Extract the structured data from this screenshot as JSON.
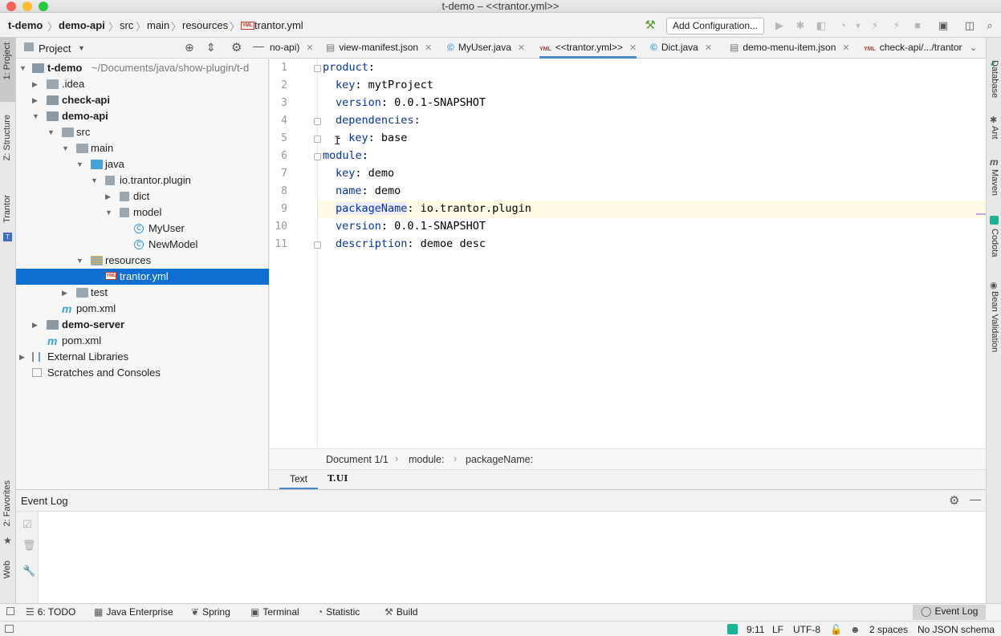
{
  "window": {
    "title": "t-demo – <<trantor.yml>>"
  },
  "nav": {
    "crumbs": [
      "t-demo",
      "demo-api",
      "src",
      "main",
      "resources",
      "trantor.yml"
    ],
    "add_config": "Add Configuration..."
  },
  "left_strip": {
    "project": "1: Project",
    "structure": "Z: Structure",
    "trantor": "Trantor",
    "favorites": "2: Favorites",
    "web": "Web"
  },
  "right_strip": {
    "database": "Database",
    "ant": "Ant",
    "maven": "Maven",
    "codota": "Codota",
    "bean": "Bean Validation"
  },
  "project": {
    "header": "Project",
    "tree": [
      {
        "label": "t-demo",
        "extra": "~/Documents/java/show-plugin/t-d",
        "bold": true
      },
      {
        "label": ".idea"
      },
      {
        "label": "check-api",
        "bold": true
      },
      {
        "label": "demo-api",
        "bold": true
      },
      {
        "label": "src"
      },
      {
        "label": "main"
      },
      {
        "label": "java"
      },
      {
        "label": "io.trantor.plugin"
      },
      {
        "label": "dict"
      },
      {
        "label": "model"
      },
      {
        "label": "MyUser"
      },
      {
        "label": "NewModel"
      },
      {
        "label": "resources"
      },
      {
        "label": "trantor.yml"
      },
      {
        "label": "test"
      },
      {
        "label": "pom.xml"
      },
      {
        "label": "demo-server",
        "bold": true
      },
      {
        "label": "pom.xml"
      },
      {
        "label": "External Libraries"
      },
      {
        "label": "Scratches and Consoles"
      }
    ]
  },
  "tabs": [
    "no-api)",
    "view-manifest.json",
    "MyUser.java",
    "<<trantor.yml>>",
    "Dict.java",
    "demo-menu-item.json",
    "check-api/.../trantor"
  ],
  "editor": {
    "lines": [
      {
        "n": "1",
        "k": "product",
        "v": ""
      },
      {
        "n": "2",
        "k": "key",
        "v": " mytProject"
      },
      {
        "n": "3",
        "k": "version",
        "v": " 0.0.1-SNAPSHOT"
      },
      {
        "n": "4",
        "k": "dependencies",
        "v": ""
      },
      {
        "n": "5",
        "k": "key",
        "v": " base"
      },
      {
        "n": "6",
        "k": "module",
        "v": ""
      },
      {
        "n": "7",
        "k": "key",
        "v": " demo"
      },
      {
        "n": "8",
        "k": "name",
        "v": " demo"
      },
      {
        "n": "9",
        "k": "packageName",
        "v": " io.trantor.plugin"
      },
      {
        "n": "10",
        "k": "version",
        "v": " 0.0.1-SNAPSHOT"
      },
      {
        "n": "11",
        "k": "description",
        "v": " demoe desc"
      }
    ],
    "dash": "- ",
    "breadcrumb": [
      "Document 1/1",
      "module:",
      "packageName:"
    ],
    "modes": [
      "Text",
      "T.UI"
    ]
  },
  "event_log": {
    "title": "Event Log"
  },
  "toolwindows": {
    "todo": "6: TODO",
    "java_ent": "Java Enterprise",
    "spring": "Spring",
    "terminal": "Terminal",
    "statistic": "Statistic",
    "build": "Build",
    "event_log": "Event Log"
  },
  "status": {
    "pos": "9:11",
    "lf": "LF",
    "enc": "UTF-8",
    "indent": "2 spaces",
    "schema": "No JSON schema"
  }
}
